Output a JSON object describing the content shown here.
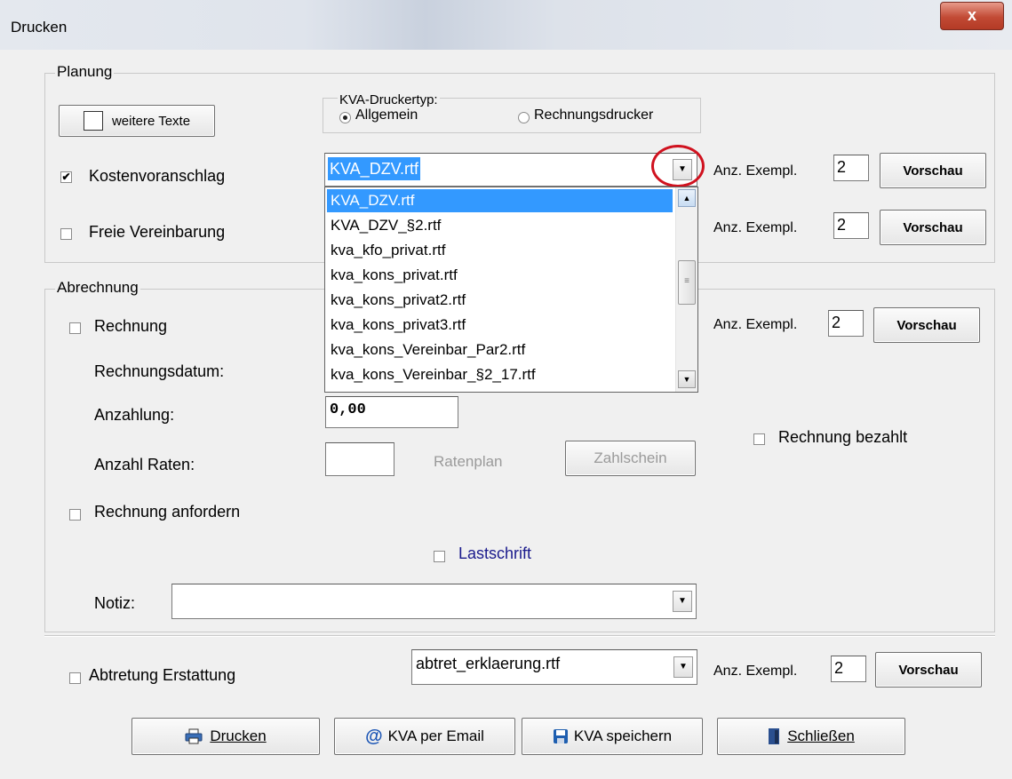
{
  "window": {
    "title": "Drucken",
    "close_glyph": "x"
  },
  "planung": {
    "legend": "Planung",
    "weitere_texte": "weitere Texte",
    "druckertyp": {
      "legend": "KVA-Druckertyp:",
      "options": [
        "Allgemein",
        "Rechnungsdrucker"
      ],
      "selected": "Allgemein"
    },
    "kostenvoranschlag": {
      "label": "Kostenvoranschlag",
      "checked": true,
      "file": "KVA_DZV.rtf",
      "copies_label": "Anz. Exempl.",
      "copies": "2",
      "preview": "Vorschau"
    },
    "freie_vereinbarung": {
      "label": "Freie Vereinbarung",
      "checked": false,
      "copies_label": "Anz. Exempl.",
      "copies": "2",
      "preview": "Vorschau"
    },
    "dropdown_items": [
      "KVA_DZV.rtf",
      "KVA_DZV_§2.rtf",
      "kva_kfo_privat.rtf",
      "kva_kons_privat.rtf",
      "kva_kons_privat2.rtf",
      "kva_kons_privat3.rtf",
      "kva_kons_Vereinbar_Par2.rtf",
      "kva_kons_Vereinbar_§2_17.rtf"
    ],
    "dropdown_selected_index": 0
  },
  "abrechnung": {
    "legend": "Abrechnung",
    "rechnung": {
      "label": "Rechnung",
      "checked": false,
      "copies_label": "Anz. Exempl.",
      "copies": "2",
      "preview": "Vorschau"
    },
    "rechnungsdatum_label": "Rechnungsdatum:",
    "anzahlung_label": "Anzahlung:",
    "anzahlung_value": "0,00",
    "anzahl_raten_label": "Anzahl Raten:",
    "ratenplan": "Ratenplan",
    "zahlschein": "Zahlschein",
    "rechnung_bezahlt": "Rechnung bezahlt",
    "rechnung_anfordern": "Rechnung anfordern",
    "lastschrift": "Lastschrift",
    "notiz_label": "Notiz:"
  },
  "abtretung": {
    "label": "Abtretung Erstattung",
    "file": "abtret_erklaerung.rtf",
    "copies_label": "Anz. Exempl.",
    "copies": "2",
    "preview": "Vorschau"
  },
  "buttons": {
    "drucken": "Drucken",
    "email": "KVA per Email",
    "speichern": "KVA speichern",
    "schliessen": "Schließen"
  },
  "colors": {
    "highlight": "#3399ff",
    "annotation": "#d0121f",
    "link_blue": "#1a1a8c"
  }
}
